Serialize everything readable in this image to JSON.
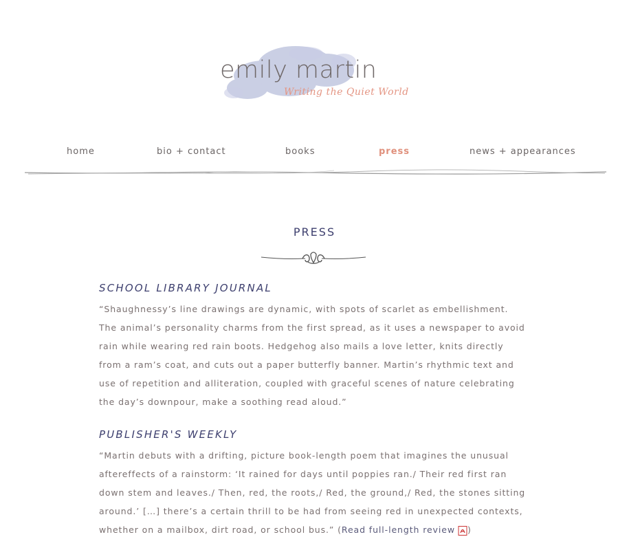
{
  "logo": {
    "name": "emily martin",
    "tagline": "Writing the Quiet World",
    "watercolor_color": "#b9bfdc"
  },
  "nav": {
    "items": [
      {
        "label": "home"
      },
      {
        "label": "bio + contact"
      },
      {
        "label": "books"
      },
      {
        "label": "press"
      },
      {
        "label": "news + appearances"
      }
    ],
    "active_color": "#e0907c"
  },
  "page": {
    "title": "PRESS"
  },
  "reviews": [
    {
      "publication": "School Library Journal",
      "quote": "“Shaughnessy’s line drawings are dynamic, with spots of scarlet as embellishment. The animal’s personality charms from the first spread, as it uses a newspaper to avoid rain while wearing red rain boots. Hedgehog also mails a love letter, knits directly from a ram’s coat, and cuts out a paper butterfly banner. Martin’s rhythmic text and use of repetition and alliteration, coupled with graceful scenes of nature celebrating the day’s downpour, make a soothing read aloud.”"
    },
    {
      "publication": "Publisher's Weekly",
      "quote": "“Martin debuts with a drifting, picture book-length poem that imagines the unusual aftereffects of a rainstorm: ‘It rained for days until poppies ran./ Their red first ran down stem and leaves./ Then, red, the roots,/ Red, the ground,/ Red, the stones sitting around.’ […] there’s a certain thrill to be had from seeing red in unexpected contexts, whether on a mailbox, dirt road, or school bus.” (",
      "link_label": "Read full-length review",
      "quote_end": ")",
      "icon": "pdf-icon"
    }
  ]
}
